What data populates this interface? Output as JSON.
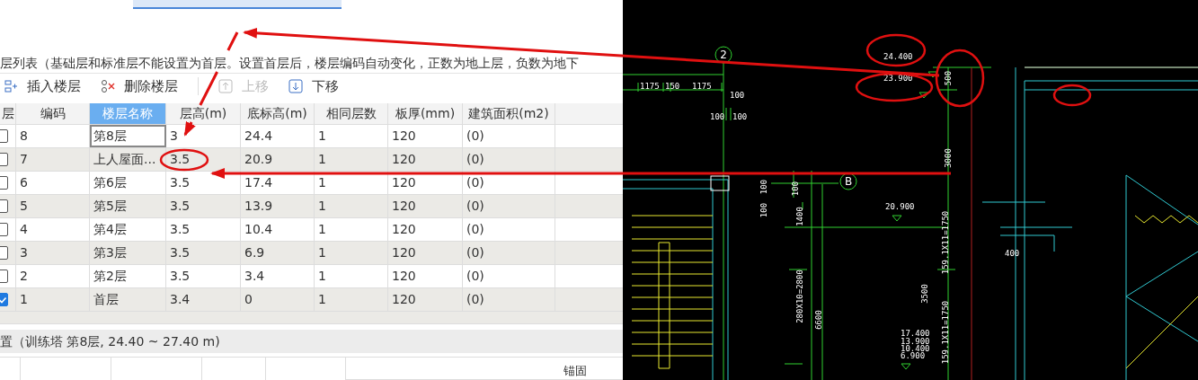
{
  "description": "层列表（基础层和标准层不能设置为首层。设置首层后，楼层编码自动变化，正数为地上层，负数为地下",
  "toolbar": [
    {
      "label": "插入楼层",
      "kind": "insert",
      "disabled": false
    },
    {
      "label": "删除楼层",
      "kind": "delete",
      "disabled": false
    },
    {
      "label": "上移",
      "kind": "up",
      "disabled": true
    },
    {
      "label": "下移",
      "kind": "down",
      "disabled": false
    }
  ],
  "table": {
    "check_column_header": "层",
    "columns": [
      {
        "label": "编码",
        "selected": false
      },
      {
        "label": "楼层名称",
        "selected": true
      },
      {
        "label": "层高(m)",
        "selected": false
      },
      {
        "label": "底标高(m)",
        "selected": false
      },
      {
        "label": "相同层数",
        "selected": false
      },
      {
        "label": "板厚(mm)",
        "selected": false
      },
      {
        "label": "建筑面积(m2)",
        "selected": false
      }
    ],
    "rows": [
      {
        "checked": false,
        "selected": true,
        "cells": [
          "8",
          "第8层",
          "3",
          "24.4",
          "1",
          "120",
          "(0)"
        ]
      },
      {
        "checked": false,
        "selected": false,
        "cells": [
          "7",
          "上人屋面...",
          "3.5",
          "20.9",
          "1",
          "120",
          "(0)"
        ]
      },
      {
        "checked": false,
        "selected": false,
        "cells": [
          "6",
          "第6层",
          "3.5",
          "17.4",
          "1",
          "120",
          "(0)"
        ]
      },
      {
        "checked": false,
        "selected": false,
        "cells": [
          "5",
          "第5层",
          "3.5",
          "13.9",
          "1",
          "120",
          "(0)"
        ]
      },
      {
        "checked": false,
        "selected": false,
        "cells": [
          "4",
          "第4层",
          "3.5",
          "10.4",
          "1",
          "120",
          "(0)"
        ]
      },
      {
        "checked": false,
        "selected": false,
        "cells": [
          "3",
          "第3层",
          "3.5",
          "6.9",
          "1",
          "120",
          "(0)"
        ]
      },
      {
        "checked": false,
        "selected": false,
        "cells": [
          "2",
          "第2层",
          "3.5",
          "3.4",
          "1",
          "120",
          "(0)"
        ]
      },
      {
        "checked": true,
        "selected": false,
        "cells": [
          "1",
          "首层",
          "3.4",
          "0",
          "1",
          "120",
          "(0)"
        ]
      }
    ]
  },
  "status": "置（训练塔  第8层, 24.40 ~ 27.40 m)",
  "lower_table": {
    "header": "锚固"
  },
  "cad": {
    "labels": [
      {
        "text": "2",
        "kind": "axis"
      },
      {
        "text": "B",
        "kind": "axis"
      },
      {
        "text": "1175",
        "kind": "dim"
      },
      {
        "text": "150",
        "kind": "dim"
      },
      {
        "text": "1175",
        "kind": "dim"
      },
      {
        "text": "100",
        "kind": "dim"
      },
      {
        "text": "100",
        "kind": "dim"
      },
      {
        "text": "100",
        "kind": "dim"
      },
      {
        "text": "24.400",
        "kind": "elev"
      },
      {
        "text": "23.900",
        "kind": "elev"
      },
      {
        "text": "500",
        "kind": "vdim"
      },
      {
        "text": "3000",
        "kind": "vdim"
      },
      {
        "text": "100",
        "kind": "vdim"
      },
      {
        "text": "100",
        "kind": "vdim"
      },
      {
        "text": "100",
        "kind": "vdim"
      },
      {
        "text": "20.900",
        "kind": "elev"
      },
      {
        "text": "1400",
        "kind": "vdim"
      },
      {
        "text": "280X10=2800",
        "kind": "vdim"
      },
      {
        "text": "6600",
        "kind": "vdim"
      },
      {
        "text": "3500",
        "kind": "vdim"
      },
      {
        "text": "159.1X11=1750",
        "kind": "vdim"
      },
      {
        "text": "159.1X11=1750",
        "kind": "vdim"
      },
      {
        "text": "400",
        "kind": "dim"
      },
      {
        "text": "17.400",
        "kind": "elev"
      },
      {
        "text": "13.900",
        "kind": "elev"
      },
      {
        "text": "10.400",
        "kind": "elev"
      },
      {
        "text": "6.900",
        "kind": "elev"
      }
    ]
  }
}
